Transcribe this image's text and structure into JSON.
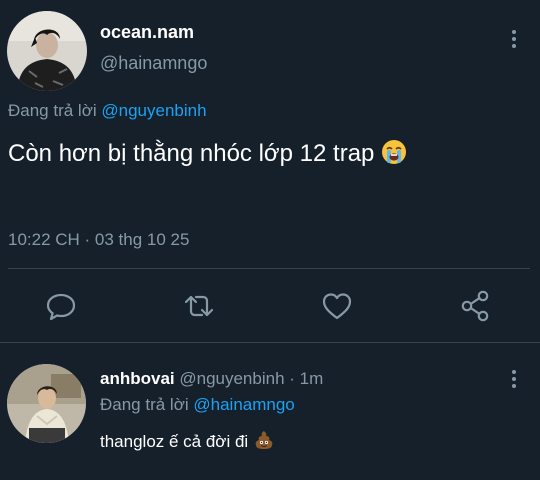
{
  "main_tweet": {
    "display_name": "ocean.nam",
    "handle": "@hainamngo",
    "replying_label": "Đang trả lời",
    "replying_to": "@nguyenbinh",
    "text": "Còn hơn bị thằng nhóc lớp 12 trap",
    "text_emoji": "loudly-crying-face",
    "timestamp": "10:22 CH · 03 thg 10 25"
  },
  "actions": {
    "reply_icon": "comment-icon",
    "retweet_icon": "retweet-icon",
    "like_icon": "heart-icon",
    "share_icon": "share-icon"
  },
  "reply_tweet": {
    "display_name": "anhbovai",
    "handle": "@nguyenbinh",
    "separator": " · ",
    "time": "1m",
    "replying_label": "Đang trả lời",
    "replying_to": "@hainamngo",
    "text": "thangloz ế cả đời đi",
    "text_emoji": "pile-of-poo"
  },
  "colors": {
    "background": "#15202b",
    "primary_text": "#ffffff",
    "secondary_text": "#8899a6",
    "accent": "#1da1f2",
    "divider": "#38444d"
  }
}
